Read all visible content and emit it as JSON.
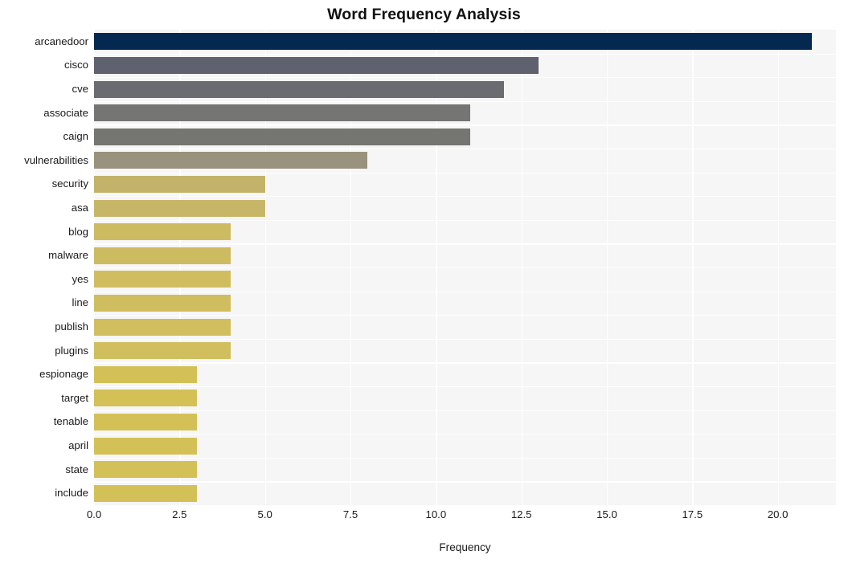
{
  "chart_data": {
    "type": "bar",
    "orientation": "horizontal",
    "title": "Word Frequency Analysis",
    "xlabel": "Frequency",
    "ylabel": "",
    "xlim": [
      0,
      21.7
    ],
    "xticks": [
      0.0,
      2.5,
      5.0,
      7.5,
      10.0,
      12.5,
      15.0,
      17.5,
      20.0
    ],
    "xtick_labels": [
      "0.0",
      "2.5",
      "5.0",
      "7.5",
      "10.0",
      "12.5",
      "15.0",
      "17.5",
      "20.0"
    ],
    "grid": true,
    "grid_color": "#ffffff",
    "plot_background": "#f6f6f6",
    "legend": null,
    "categories": [
      "arcanedoor",
      "cisco",
      "cve",
      "associate",
      "caign",
      "vulnerabilities",
      "security",
      "asa",
      "blog",
      "malware",
      "yes",
      "line",
      "publish",
      "plugins",
      "espionage",
      "target",
      "tenable",
      "april",
      "state",
      "include"
    ],
    "values": [
      21,
      13,
      12,
      11,
      11,
      8,
      5,
      5,
      4,
      4,
      4,
      4,
      4,
      4,
      3,
      3,
      3,
      3,
      3,
      3
    ],
    "bar_colors": [
      "#042850",
      "#5f616f",
      "#6b6c71",
      "#757573",
      "#757572",
      "#99927c",
      "#c3b36a",
      "#c7b668",
      "#cdbb62",
      "#cdbb62",
      "#cfbd60",
      "#cfbd60",
      "#d0be5f",
      "#d0be5f",
      "#d3c158",
      "#d3c158",
      "#d3c158",
      "#d3c158",
      "#d3c158",
      "#d3c158"
    ]
  }
}
